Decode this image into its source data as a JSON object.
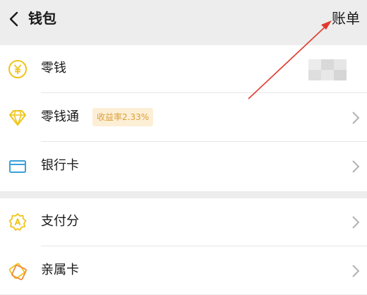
{
  "header": {
    "title": "钱包",
    "bill_label": "账单",
    "back_icon": "chevron-left-icon"
  },
  "group1": [
    {
      "label": "零钱",
      "icon": "yuan-coin-icon",
      "icon_color": "#f0c419"
    },
    {
      "label": "零钱通",
      "icon": "diamond-icon",
      "icon_color": "#f0c419",
      "badge": "收益率2.33%"
    },
    {
      "label": "银行卡",
      "icon": "bank-card-icon",
      "icon_color": "#3aa1d9"
    }
  ],
  "group2": [
    {
      "label": "支付分",
      "icon": "payscore-badge-icon",
      "icon_color": "#f0c419"
    },
    {
      "label": "亲属卡",
      "icon": "family-card-icon",
      "icon_color": "#f0c419"
    }
  ],
  "colors": {
    "background": "#ededed",
    "badge_bg": "#fcefd6",
    "badge_text": "#dd9e38",
    "annotation_arrow": "#e03a2e"
  }
}
